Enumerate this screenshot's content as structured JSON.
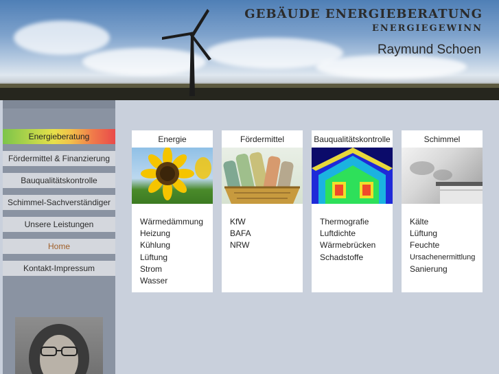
{
  "header": {
    "title_main": "GEBÄUDE ENERGIEBERATUNG",
    "title_sub": "ENERGIEGEWINN",
    "name": "Raymund Schoen"
  },
  "sidebar": {
    "items": [
      {
        "label": "Energieberatung",
        "state": "active"
      },
      {
        "label": "Fördermittel & Finanzierung",
        "state": "normal"
      },
      {
        "label": "Bauqualitätskontrolle",
        "state": "normal"
      },
      {
        "label": "Schimmel-Sachverständiger",
        "state": "normal"
      },
      {
        "label": "Unsere Leistungen",
        "state": "normal"
      },
      {
        "label": "Home",
        "state": "current"
      },
      {
        "label": "Kontakt-Impressum",
        "state": "normal"
      }
    ]
  },
  "cards": [
    {
      "title": "Energie",
      "image": "sunflower-image",
      "items": [
        "Wärmedämmung",
        "Heizung",
        "Kühlung",
        "Lüftung",
        "Strom",
        "Wasser"
      ]
    },
    {
      "title": "Fördermittel",
      "image": "money-basket-image",
      "items": [
        "KfW",
        "BAFA",
        "NRW"
      ]
    },
    {
      "title": "Bauqualitätskontrolle",
      "image": "thermography-image",
      "items": [
        "Thermografie",
        "Luftdichte",
        "Wärmebrücken",
        "Schadstoffe"
      ]
    },
    {
      "title": "Schimmel",
      "image": "mold-wall-image",
      "items": [
        "Kälte",
        "Lüftung",
        "Feuchte",
        "Ursachenermittlung",
        "Sanierung"
      ]
    }
  ],
  "colors": {
    "background": "#c9d0dc",
    "sidebar": "#8a93a2",
    "nav_item": "#d4d7dd",
    "home_link": "#a0602a"
  }
}
